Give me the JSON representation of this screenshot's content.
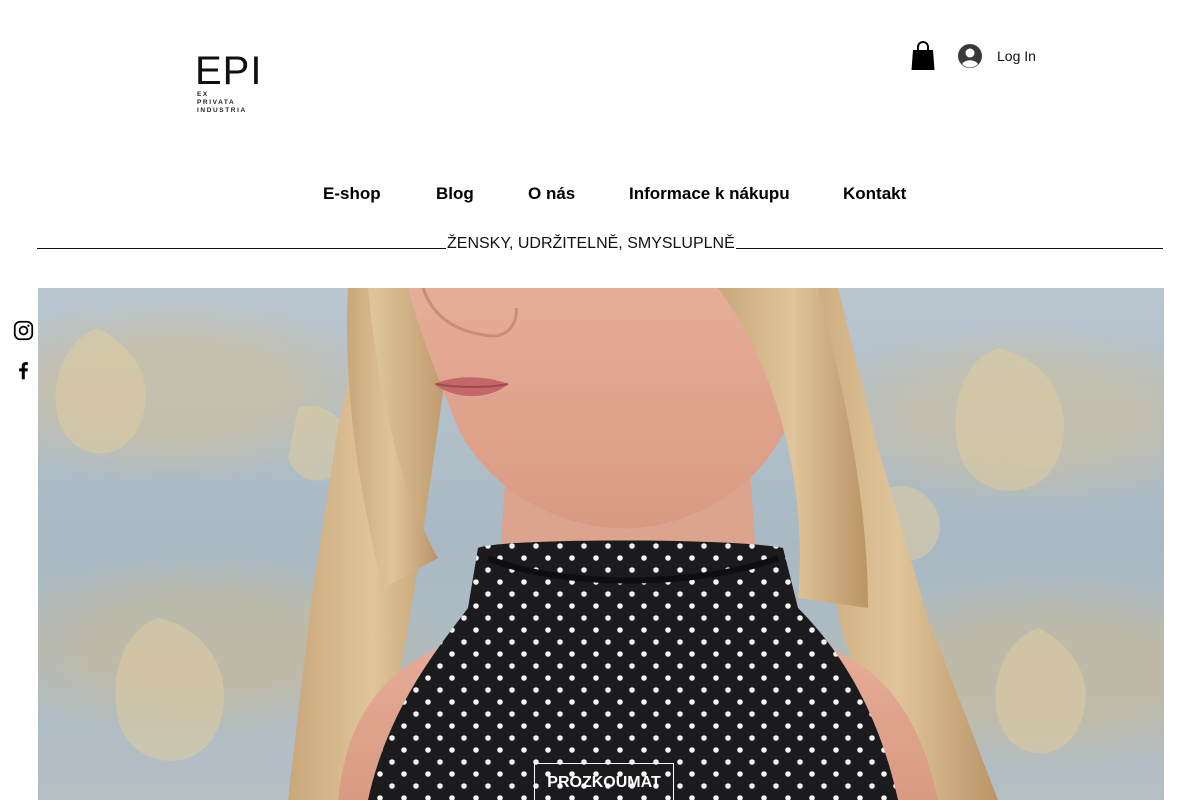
{
  "logo": {
    "mark": "EPI",
    "sub_lines": [
      "EX",
      "PRIVATA",
      "INDUSTRIA"
    ]
  },
  "header": {
    "cart_icon": "shopping-bag-icon",
    "login_icon": "user-avatar-icon",
    "login_label": "Log In"
  },
  "nav": {
    "items": [
      {
        "label": "E-shop"
      },
      {
        "label": "Blog"
      },
      {
        "label": "O nás"
      },
      {
        "label": "Informace k nákupu"
      },
      {
        "label": "Kontakt"
      }
    ]
  },
  "tagline": "ŽENSKY, UDRŽITELNĚ, SMYSLUPLNĚ",
  "social": {
    "icons": [
      "instagram-icon",
      "facebook-icon"
    ]
  },
  "hero": {
    "cta_label": "PROZKOUMAT"
  },
  "colors": {
    "text": "#000000",
    "background": "#ffffff",
    "hero_wallpaper": "#b0bfc8",
    "dress": "#1b1b1d"
  }
}
